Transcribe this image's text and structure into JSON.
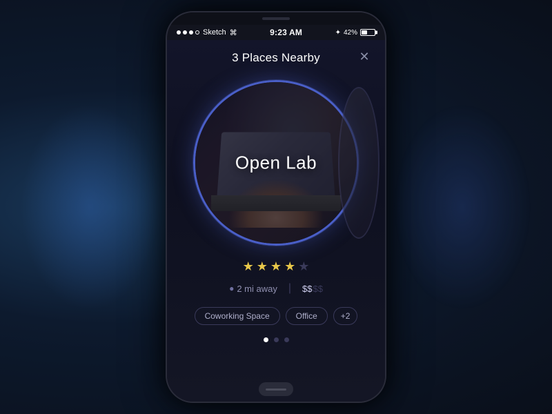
{
  "phone": {
    "statusBar": {
      "signals": [
        "filled",
        "filled",
        "filled",
        "empty"
      ],
      "carrier": "Sketch",
      "wifi": "⌕",
      "time": "9:23 AM",
      "bluetooth": "✦",
      "battery": "42%"
    }
  },
  "header": {
    "title": "3 Places Nearby",
    "closeLabel": "✕"
  },
  "card": {
    "placeName": "Open Lab",
    "rating": 3.5,
    "starsMax": 5,
    "distance": "2 mi away",
    "priceActive": "$$",
    "priceInactive": "$$",
    "tags": [
      "Coworking Space",
      "Office",
      "+2"
    ]
  },
  "pagination": {
    "dots": [
      true,
      false,
      false
    ]
  },
  "icons": {
    "pin": "📍",
    "close": "✕",
    "starFull": "★",
    "starEmpty": "★"
  }
}
